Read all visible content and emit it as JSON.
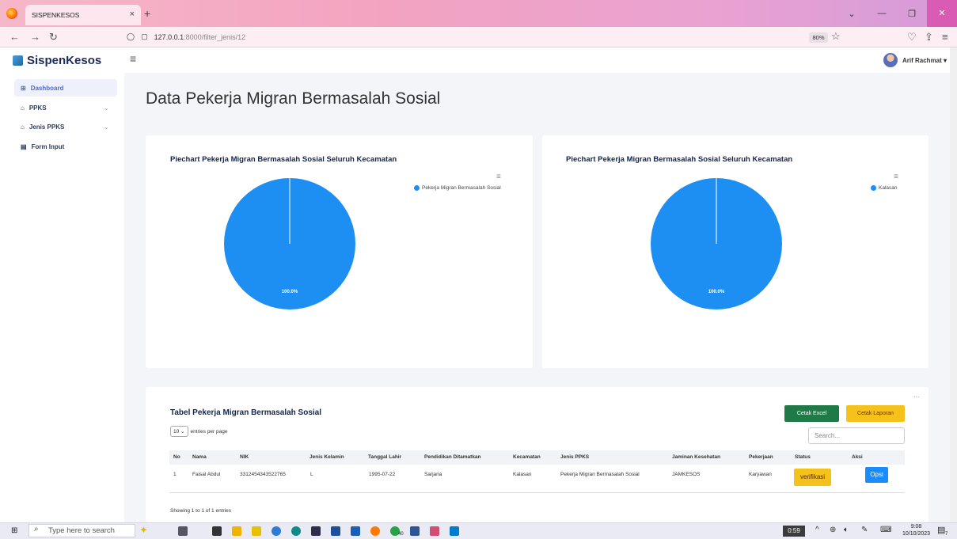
{
  "browser": {
    "tab_title": "SISPENKESOS",
    "tab_close": "×",
    "new_tab": "+",
    "url_host": "127.0.0.1",
    "url_path": ":8000/filter_jenis/12",
    "zoom": "80%"
  },
  "app": {
    "brand": "SispenKesos",
    "user_name": "Arif Rachmat ▾"
  },
  "sidebar": {
    "items": [
      {
        "label": "Dashboard",
        "icon": "grid-icon"
      },
      {
        "label": "PPKS",
        "icon": "building-icon"
      },
      {
        "label": "Jenis PPKS",
        "icon": "building-icon"
      },
      {
        "label": "Form Input",
        "icon": "form-icon"
      }
    ]
  },
  "page": {
    "title": "Data Pekerja Migran Bermasalah Sosial"
  },
  "chart_data": [
    {
      "type": "pie",
      "title": "Piechart Pekerja Migran Bermasalah Sosial Seluruh Kecamatan",
      "categories": [
        "Pekerja Migran Bermasalah Sosial"
      ],
      "values": [
        100
      ],
      "data_labels": [
        "100.0%"
      ],
      "colors": [
        "#1e8ff2"
      ],
      "legend": "top-right"
    },
    {
      "type": "pie",
      "title": "Piechart Pekerja Migran Bermasalah Sosial Seluruh Kecamatan",
      "categories": [
        "Kalasan"
      ],
      "values": [
        100
      ],
      "data_labels": [
        "100.0%"
      ],
      "colors": [
        "#1e8ff2"
      ],
      "legend": "top-right"
    }
  ],
  "table": {
    "title": "Tabel Pekerja Migran Bermasalah Sosial",
    "btn_excel": "Cetak Excel",
    "btn_laporan": "Cetak Laporan",
    "entries_value": "10",
    "entries_label": "entries per page",
    "search_placeholder": "Search...",
    "columns": [
      "No",
      "Nama",
      "NIK",
      "Jenis Kelamin",
      "Tanggal Lahir",
      "Pendidikan Ditamatkan",
      "Kecamatan",
      "Jenis PPKS",
      "Jaminan Kesehatan",
      "Pekerjaan",
      "Status",
      "Aksi"
    ],
    "rows": [
      [
        "1",
        "Faisal Abdul",
        "3312454343522765",
        "L",
        "1995-07-22",
        "Sarjana",
        "Kalasan",
        "Pekerja Migran Bermasalah Sosial",
        "JAMKESOS",
        "Karyawan"
      ]
    ],
    "status_button": "verifikasi",
    "action_button": "Opsi",
    "showing": "Showing 1 to 1 of 1 entries",
    "more": "..."
  },
  "taskbar": {
    "search_placeholder": "Type here to search",
    "badge_count": "40",
    "timer": "0:59",
    "time": "9:08",
    "date": "10/10/2023",
    "notif_count": "7"
  },
  "colors": {
    "accent": "#4b6bd6",
    "pie": "#1e8ff2",
    "excel": "#1f7a47",
    "laporan": "#f5c21b",
    "opsi": "#1a8cff"
  }
}
